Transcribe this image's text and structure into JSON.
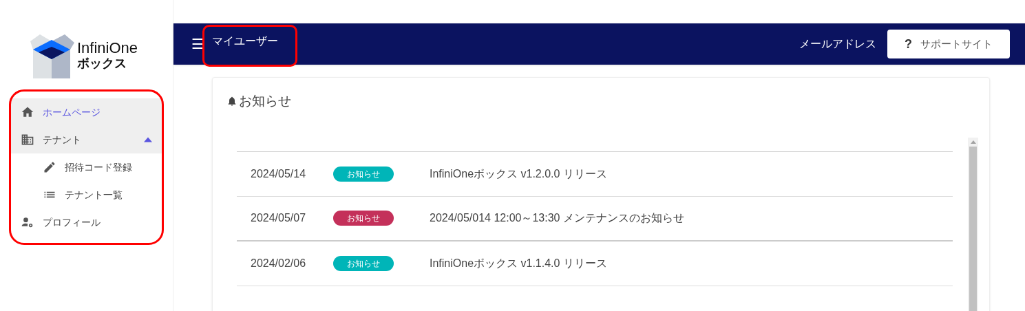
{
  "logo": {
    "line1": "InfiniOne",
    "line2": "ボックス"
  },
  "sidebar": {
    "items": [
      {
        "label": "ホームページ",
        "kind": "home",
        "selected": true
      },
      {
        "label": "テナント",
        "kind": "building",
        "selected": false,
        "expanded": true,
        "children": [
          {
            "label": "招待コード登録",
            "kind": "pencil",
            "selected": false
          },
          {
            "label": "テナント一覧",
            "kind": "list",
            "selected": false
          }
        ]
      },
      {
        "label": "プロフィール",
        "kind": "user-gear",
        "selected": false
      }
    ]
  },
  "header": {
    "menu": "☰",
    "title": "マイユーザー",
    "email": "メールアドレス",
    "support_icon": "?",
    "support_button": "サポートサイト"
  },
  "notices": {
    "title": "お知らせ",
    "rows": [
      {
        "date": "2024/05/14",
        "tag": "お知らせ",
        "color": "#00b5b8",
        "text": "InfiniOneボックス v1.2.0.0 リリース"
      },
      {
        "date": "2024/05/07",
        "tag": "お知らせ",
        "color": "#c4305a",
        "text": "2024/05/014 12:00～13:30 メンテナンスのお知らせ"
      },
      {
        "date": "2024/02/06",
        "tag": "お知らせ",
        "color": "#00b5b8",
        "text": "InfiniOneボックス v1.1.4.0 リリース"
      }
    ]
  }
}
